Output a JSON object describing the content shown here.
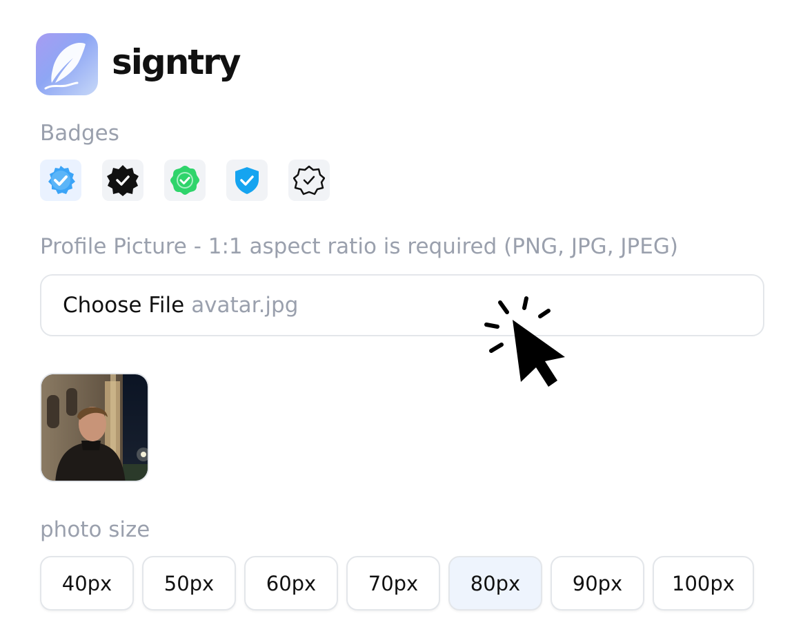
{
  "brand": {
    "name": "signtry",
    "logo_icon": "feather-quill-icon"
  },
  "badges": {
    "label": "Badges",
    "items": [
      {
        "name": "blue-scalloped-check",
        "icon": "verified-badge-icon",
        "color": "#3ba4f7",
        "selected": true
      },
      {
        "name": "black-scalloped-check",
        "icon": "verified-badge-icon",
        "color": "#111111",
        "selected": false
      },
      {
        "name": "green-scalloped-check",
        "icon": "verified-badge-icon",
        "color": "#2fd46b",
        "selected": false
      },
      {
        "name": "blue-shield-check",
        "icon": "shield-check-icon",
        "color": "#15a4f0",
        "selected": false
      },
      {
        "name": "outline-scalloped-check",
        "icon": "verified-badge-outline-icon",
        "color": "#111111",
        "selected": false
      }
    ]
  },
  "profile_picture": {
    "label": "Profile Picture - 1:1 aspect ratio is required (PNG, JPG, JPEG)",
    "button_label": "Choose File",
    "file_name": "avatar.jpg"
  },
  "photo_size": {
    "label": "photo size",
    "options": [
      "40px",
      "50px",
      "60px",
      "70px",
      "80px",
      "90px",
      "100px"
    ],
    "selected": "80px"
  },
  "colors": {
    "label_gray": "#9aa0ad",
    "border": "#e3e6ea",
    "selected_bg": "#eef4fd"
  }
}
